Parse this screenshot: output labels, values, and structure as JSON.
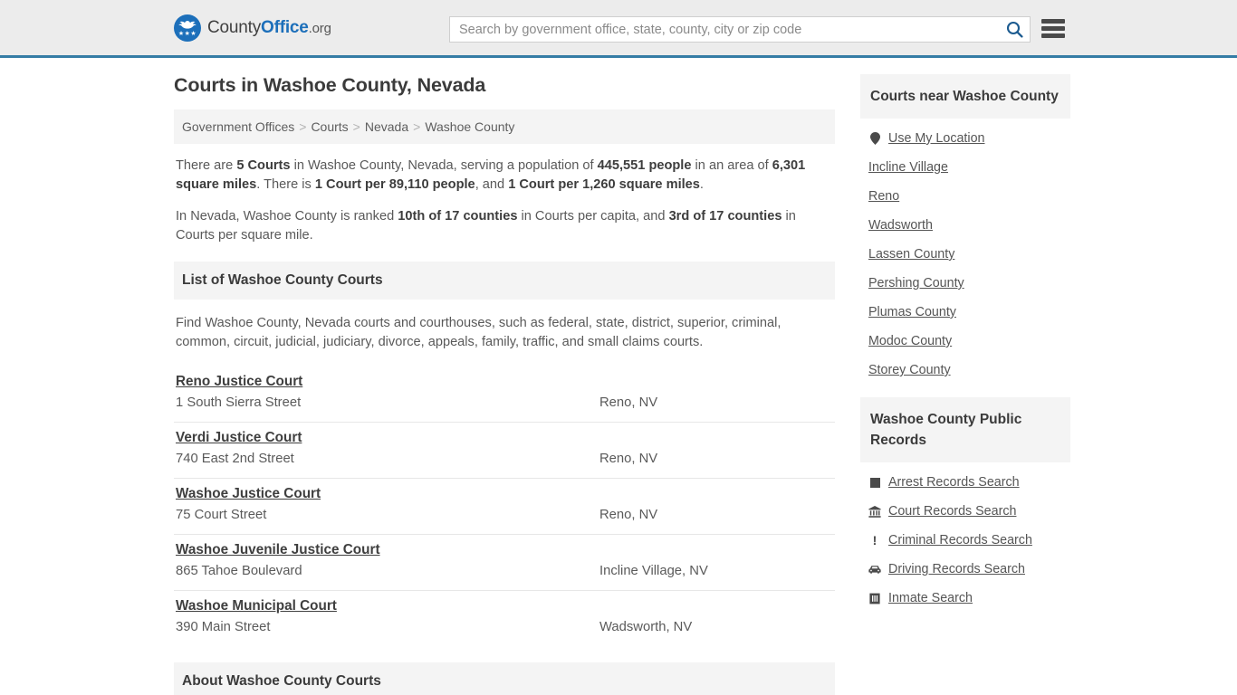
{
  "header": {
    "brand": {
      "part1": "County",
      "part2": "Office",
      "part3": ".org"
    },
    "logo_icon": "eagle-shield-logo",
    "stars": "★★★",
    "search": {
      "placeholder": "Search by government office, state, county, city or zip code",
      "value": "",
      "icon": "search-icon"
    },
    "menu_icon": "hamburger-menu-icon",
    "accent_color": "#357ca5",
    "brand_blue": "#1c6fba",
    "background": "#ececec"
  },
  "page": {
    "title": "Courts in Washoe County, Nevada"
  },
  "breadcrumb": {
    "separator": ">",
    "items": [
      {
        "label": "Government Offices",
        "current": false
      },
      {
        "label": "Courts",
        "current": false
      },
      {
        "label": "Nevada",
        "current": false
      },
      {
        "label": "Washoe County",
        "current": true
      }
    ]
  },
  "intro": {
    "paragraph1": [
      {
        "text": "There are ",
        "bold": false
      },
      {
        "text": "5 Courts",
        "bold": true
      },
      {
        "text": " in Washoe County, Nevada, serving a population of ",
        "bold": false
      },
      {
        "text": "445,551 people",
        "bold": true
      },
      {
        "text": " in an area of ",
        "bold": false
      },
      {
        "text": "6,301 square miles",
        "bold": true
      },
      {
        "text": ". There is ",
        "bold": false
      },
      {
        "text": "1 Court per 89,110 people",
        "bold": true
      },
      {
        "text": ", and ",
        "bold": false
      },
      {
        "text": "1 Court per 1,260 square miles",
        "bold": true
      },
      {
        "text": ".",
        "bold": false
      }
    ],
    "paragraph2": [
      {
        "text": "In Nevada, Washoe County is ranked ",
        "bold": false
      },
      {
        "text": "10th of 17 counties",
        "bold": true
      },
      {
        "text": " in Courts per capita, and ",
        "bold": false
      },
      {
        "text": "3rd of 17 counties",
        "bold": true
      },
      {
        "text": " in Courts per square mile.",
        "bold": false
      }
    ]
  },
  "list_section": {
    "heading": "List of Washoe County Courts",
    "description": "Find Washoe County, Nevada courts and courthouses, such as federal, state, district, superior, criminal, common, circuit, judicial, judiciary, divorce, appeals, family, traffic, and small claims courts.",
    "courts": [
      {
        "name": "Reno Justice Court",
        "address": "1 South Sierra Street",
        "city": "Reno, NV"
      },
      {
        "name": "Verdi Justice Court",
        "address": "740 East 2nd Street",
        "city": "Reno, NV"
      },
      {
        "name": "Washoe Justice Court",
        "address": "75 Court Street",
        "city": "Reno, NV"
      },
      {
        "name": "Washoe Juvenile Justice Court",
        "address": "865 Tahoe Boulevard",
        "city": "Incline Village, NV"
      },
      {
        "name": "Washoe Municipal Court",
        "address": "390 Main Street",
        "city": "Wadsworth, NV"
      }
    ]
  },
  "about_section": {
    "heading": "About Washoe County Courts"
  },
  "sidebar": {
    "nearby": {
      "heading": "Courts near Washoe County",
      "items": [
        {
          "label": "Use My Location",
          "icon": "map-pin-icon"
        },
        {
          "label": "Incline Village",
          "icon": ""
        },
        {
          "label": "Reno",
          "icon": ""
        },
        {
          "label": "Wadsworth",
          "icon": ""
        },
        {
          "label": "Lassen County",
          "icon": ""
        },
        {
          "label": "Pershing County",
          "icon": ""
        },
        {
          "label": "Plumas County",
          "icon": ""
        },
        {
          "label": "Modoc County",
          "icon": ""
        },
        {
          "label": "Storey County",
          "icon": ""
        }
      ]
    },
    "public_records": {
      "heading": "Washoe County Public Records",
      "items": [
        {
          "label": "Arrest Records Search",
          "icon": "fingerprint-square-icon"
        },
        {
          "label": "Court Records Search",
          "icon": "courthouse-icon"
        },
        {
          "label": "Criminal Records Search",
          "icon": "exclamation-icon"
        },
        {
          "label": "Driving Records Search",
          "icon": "car-icon"
        },
        {
          "label": "Inmate Search",
          "icon": "jail-icon"
        }
      ]
    }
  }
}
